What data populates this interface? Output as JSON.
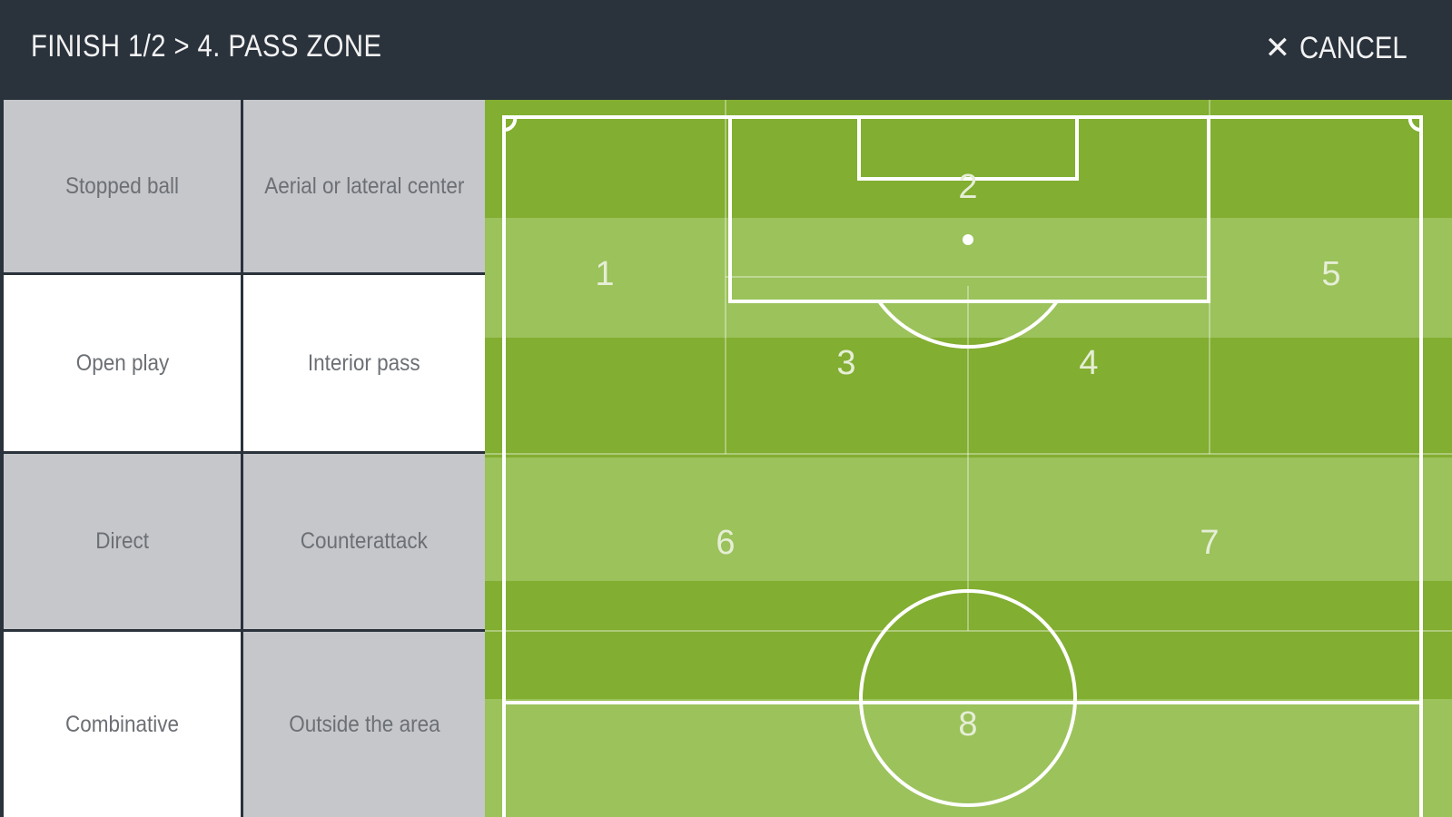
{
  "header": {
    "breadcrumb": "FINISH 1/2 > 4. PASS ZONE",
    "cancel_icon": "✕",
    "cancel_label": "CANCEL"
  },
  "options": [
    {
      "label": "Stopped ball",
      "selected": false
    },
    {
      "label": "Aerial or lateral center",
      "selected": false
    },
    {
      "label": "Open play",
      "selected": true
    },
    {
      "label": "Interior pass",
      "selected": true
    },
    {
      "label": "Direct",
      "selected": false
    },
    {
      "label": "Counterattack",
      "selected": false
    },
    {
      "label": "Combinative",
      "selected": true
    },
    {
      "label": "Outside the area",
      "selected": false
    }
  ],
  "pitch": {
    "zones": [
      "1",
      "2",
      "3",
      "4",
      "5",
      "6",
      "7",
      "8"
    ],
    "colors": {
      "dark_green": "#82ae31",
      "light_green": "#9bc25b",
      "lines": "#ffffff"
    }
  }
}
